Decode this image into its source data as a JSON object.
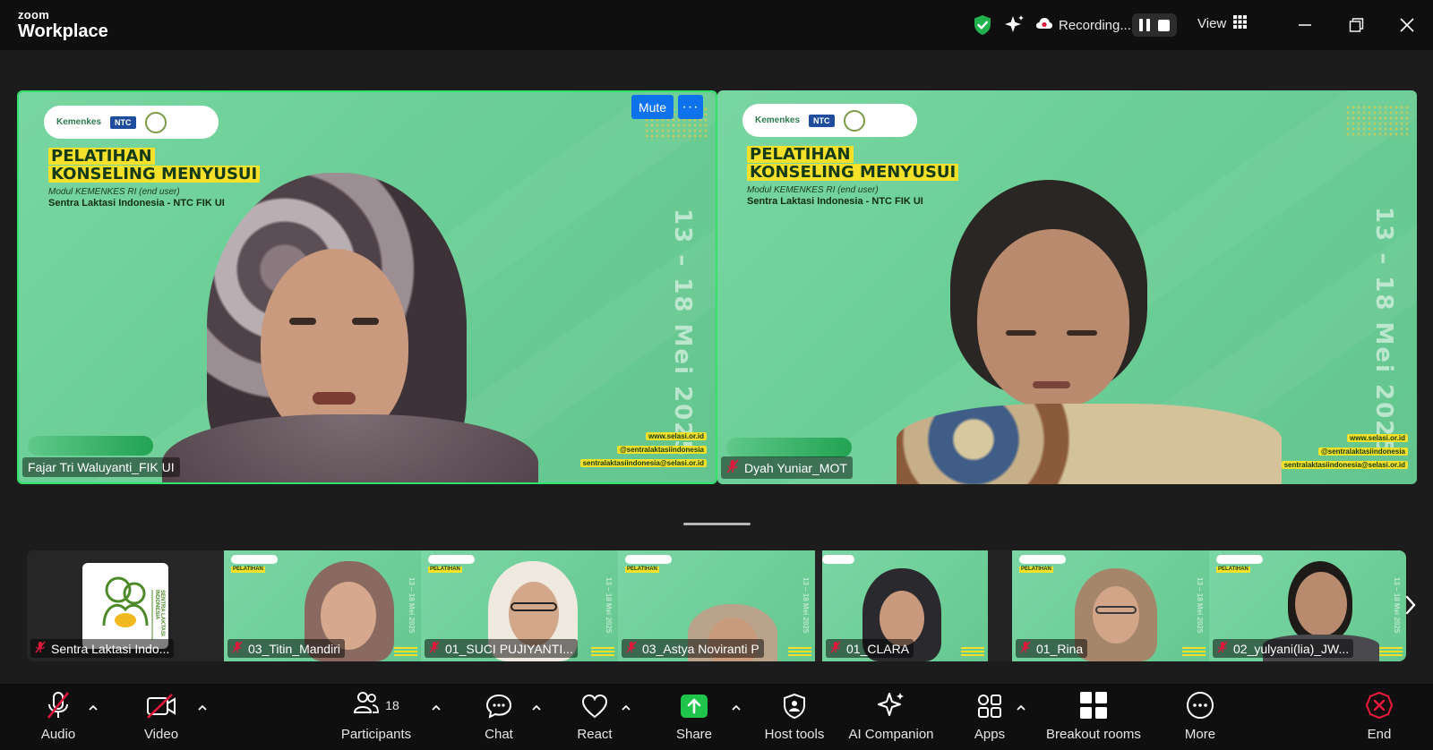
{
  "app": {
    "brand_top": "zoom",
    "brand_bottom": "Workplace"
  },
  "titlebar": {
    "recording_label": "Recording...",
    "view_label": "View",
    "icons": [
      "shield-check-icon",
      "sparkle-icon",
      "cloud-record-icon",
      "pause-icon",
      "stop-icon",
      "grid-view-icon",
      "minimize-icon",
      "restore-icon",
      "close-icon"
    ],
    "accent_green": "#21b24d"
  },
  "slide": {
    "brand_kemenkes": "Kemenkes",
    "brand_ntc": "NTC",
    "title_line1": "PELATIHAN",
    "title_line2": "KONSELING MENYUSUI",
    "subtitle": "Modul KEMENKES RI (end user)",
    "org": "Sentra Laktasi Indonesia - NTC FIK UI",
    "date": "13 – 18 Mei 2025",
    "website": "www.selasi.or.id",
    "social": "@sentralaktasiindonesia",
    "email": "sentralaktasiindonesia@selasi.or.id",
    "bg_color": "#6fcf98",
    "highlight_color": "#f5e12a"
  },
  "speakers": [
    {
      "name": "Fajar Tri Waluyanti_FIK UI",
      "muted": false,
      "active": true
    },
    {
      "name": "Dyah Yuniar_MOT",
      "muted": true,
      "active": false
    }
  ],
  "tile_controls": {
    "mute_label": "Mute",
    "more_label": "···",
    "button_color": "#0e72ed"
  },
  "thumbnails": [
    {
      "name": "Sentra Laktasi Indo...",
      "muted": true
    },
    {
      "name": "03_Titin_Mandiri",
      "muted": true
    },
    {
      "name": "01_SUCI PUJIYANTI...",
      "muted": true
    },
    {
      "name": "03_Astya Noviranti P",
      "muted": true
    },
    {
      "name": "01_CLARA",
      "muted": true
    },
    {
      "name": "01_Rina",
      "muted": true
    },
    {
      "name": "02_yulyani(lia)_JW...",
      "muted": true
    }
  ],
  "logo_card_text": "SENTRA LAKTASI INDONESIA",
  "toolbar": {
    "audio": "Audio",
    "video": "Video",
    "participants": "Participants",
    "participants_count": "18",
    "chat": "Chat",
    "react": "React",
    "share": "Share",
    "host_tools": "Host tools",
    "ai_companion": "AI Companion",
    "apps": "Apps",
    "breakout_rooms": "Breakout rooms",
    "more": "More",
    "end": "End",
    "share_color": "#1fc44a",
    "end_color": "#e3183d",
    "muted_color": "#e3183d"
  }
}
